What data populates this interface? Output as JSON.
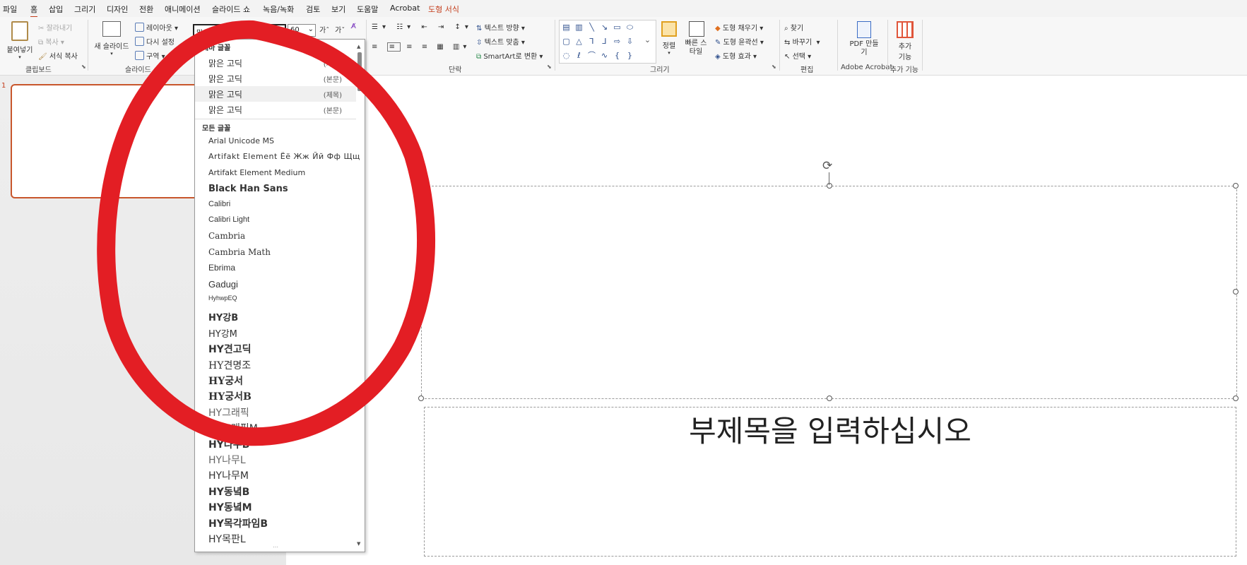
{
  "menu": {
    "tabs": [
      "파일",
      "홈",
      "삽입",
      "그리기",
      "디자인",
      "전환",
      "애니메이션",
      "슬라이드 쇼",
      "녹음/녹화",
      "검토",
      "보기",
      "도움말",
      "Acrobat",
      "도형 서식"
    ]
  },
  "ribbon": {
    "clipboard": {
      "paste": "붙여넣기",
      "cut": "잘라내기",
      "copy": "복사",
      "format_painter": "서식 복사",
      "label": "클립보드"
    },
    "slides": {
      "new_slide": "새 슬라이드",
      "layout": "레이아웃",
      "reset": "다시 설정",
      "section": "구역",
      "label": "슬라이드"
    },
    "font": {
      "font_name": "맑은 고딕",
      "font_size": "60",
      "grow": "가",
      "shrink": "가"
    },
    "paragraph": {
      "text_direction": "텍스트 방향",
      "align_text": "텍스트 맞춤",
      "smartart": "SmartArt로 변환",
      "label": "단락"
    },
    "drawing": {
      "arrange": "정렬",
      "quick_styles": "빠른 스타일",
      "fill": "도형 채우기",
      "outline": "도형 윤곽선",
      "effects": "도형 효과",
      "label": "그리기"
    },
    "editing": {
      "find": "찾기",
      "replace": "바꾸기",
      "select": "선택",
      "label": "편집"
    },
    "acrobat": {
      "create_pdf": "PDF 만들기",
      "label": "Adobe Acrobat"
    },
    "addins": {
      "label1": "추가",
      "label2": "기능",
      "group_label": "추가 기능"
    }
  },
  "slide_panel": {
    "slide_number": "1"
  },
  "slide": {
    "subtitle_placeholder": "부제목을 입력하십시오"
  },
  "font_dropdown": {
    "theme_header": "테마 글꼴",
    "theme_fonts": [
      {
        "name": "맑은 고딕",
        "tag": "(제목)"
      },
      {
        "name": "맑은 고딕",
        "tag": "(본문)"
      },
      {
        "name": "맑은 고딕",
        "tag": "(제목)"
      },
      {
        "name": "맑은 고딕",
        "tag": "(본문)"
      }
    ],
    "all_header": "모든 글꼴",
    "fonts": [
      "Arial Unicode MS",
      "Artifakt Element   Ёё Жж Йй Фф Щщ",
      "Artifakt Element Medium",
      "Black Han Sans",
      "Calibri",
      "Calibri Light",
      "Cambria",
      "Cambria Math",
      "Ebrima",
      "Gadugi",
      "HyhwpEQ",
      "HY강B",
      "HY강M",
      "HY견고딕",
      "HY견명조",
      "HY궁서",
      "HY궁서B",
      "HY그래픽",
      "HY그래픽M",
      "HY나무B",
      "HY나무L",
      "HY나무M",
      "HY동녘B",
      "HY동녘M",
      "HY목각파임B",
      "HY목판L"
    ]
  },
  "colors": {
    "accent": "#c43e1c",
    "annotation": "#e31e24"
  }
}
